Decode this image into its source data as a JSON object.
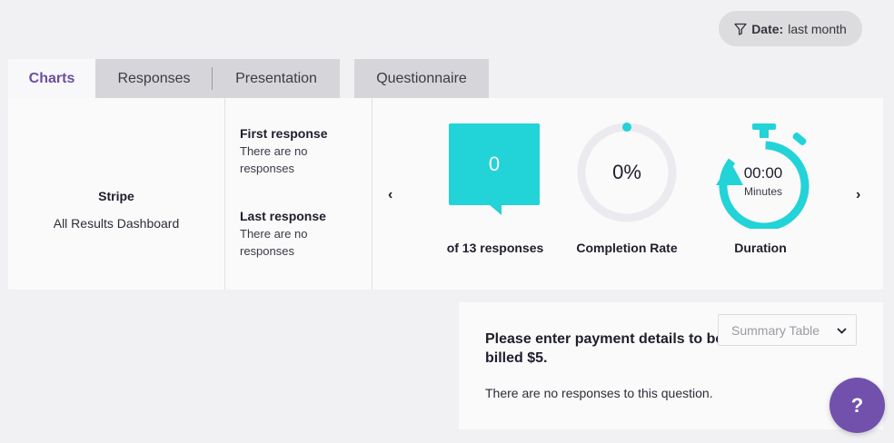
{
  "filter": {
    "label": "Date:",
    "value": "last month"
  },
  "tabs": [
    {
      "label": "Charts"
    },
    {
      "label": "Responses"
    },
    {
      "label": "Presentation"
    },
    {
      "label": "Questionnaire"
    }
  ],
  "survey": {
    "name": "Stripe",
    "subtitle": "All Results Dashboard"
  },
  "responses": {
    "first_title": "First response",
    "first_text": "There are no responses",
    "last_title": "Last response",
    "last_text": "There are no responses"
  },
  "stats": {
    "count_value": "0",
    "count_label": "of 13 responses",
    "completion_value": "0%",
    "completion_label": "Completion Rate",
    "completion_fraction": 0,
    "duration_value": "00:00",
    "duration_unit": "Minutes",
    "duration_label": "Duration"
  },
  "nav": {
    "prev": "‹",
    "next": "›"
  },
  "question": {
    "title": "Please enter payment details to be billed $5.",
    "empty_text": "There are no responses to this question.",
    "view_select": "Summary Table"
  },
  "help": {
    "label": "?"
  },
  "colors": {
    "accent": "#22d3d8",
    "brand": "#7251ad"
  },
  "icons": {
    "filter": "filter-icon",
    "chevron": "chevron-down-icon",
    "stopwatch": "stopwatch-icon"
  }
}
